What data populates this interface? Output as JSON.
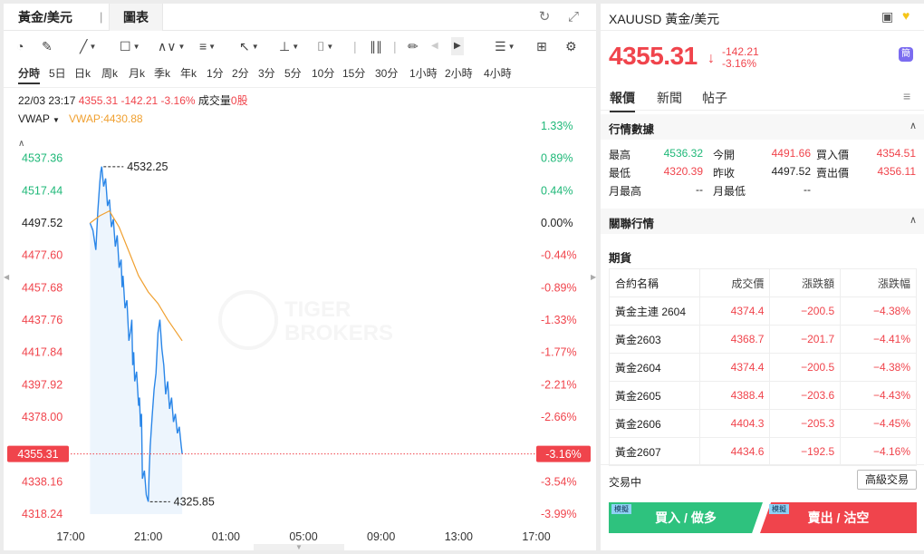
{
  "left_tabs": {
    "symbol": "黃金/美元",
    "separator": "|",
    "chart": "圖表"
  },
  "toolbar_icons": [
    "gauge-icon",
    "pen-icon",
    "line-icon",
    "rect-icon",
    "pattern-icon",
    "fib-icon",
    "arrow-icon",
    "measure-icon",
    "text-icon",
    "bar-icon",
    "eraser-icon",
    "prev-icon",
    "next-icon",
    "layout-icon",
    "grid-icon",
    "settings-icon"
  ],
  "periods": [
    "分時",
    "5日",
    "日k",
    "周k",
    "月k",
    "季k",
    "年k",
    "1分",
    "2分",
    "3分",
    "5分",
    "10分",
    "15分",
    "30分",
    "1小時",
    "2小時",
    "4小時"
  ],
  "active_period": "分時",
  "info": {
    "datetime": "22/03 23:17",
    "price": "4355.31",
    "change": "-142.21",
    "change_pct": "-3.16%",
    "volume_label": "成交量",
    "volume": "0股"
  },
  "indicator": {
    "name": "VWAP",
    "label": "VWAP:4430.88"
  },
  "watermark": {
    "line1": "TIGER",
    "line2": "BROKERS"
  },
  "current_price_tag": "4355.31",
  "current_pct_tag": "-3.16%",
  "colors": {
    "up": "#1fb878",
    "down": "#f0444c",
    "line": "#2a86e8",
    "vwap": "#f0a030",
    "neutral": "#222222"
  },
  "chart_data": {
    "type": "line",
    "x_ticks": [
      "17:00",
      "21:00",
      "01:00",
      "05:00",
      "09:00",
      "13:00",
      "17:00"
    ],
    "x_tick_hours": [
      17,
      21,
      25,
      29,
      33,
      37,
      41
    ],
    "x_range": [
      17,
      41
    ],
    "y_ticks": [
      "4537.36",
      "4517.44",
      "4497.52",
      "4477.60",
      "4457.68",
      "4437.76",
      "4417.84",
      "4397.92",
      "4378.00",
      "4338.16",
      "4318.24"
    ],
    "pct_ticks": [
      "1.33%",
      "0.89%",
      "0.44%",
      "0.00%",
      "-0.44%",
      "-0.89%",
      "-1.33%",
      "-1.77%",
      "-2.21%",
      "-2.66%",
      "-3.54%",
      "-3.99%"
    ],
    "pct_tick_values": [
      4557.28,
      4537.36,
      4517.44,
      4497.52,
      4477.6,
      4457.68,
      4437.76,
      4417.84,
      4397.92,
      4378.0,
      4338.16,
      4318.24
    ],
    "ylim": [
      4318.24,
      4557.28
    ],
    "prev_close": 4497.52,
    "high_label": "4532.25",
    "low_label": "4325.85",
    "high": 4532.25,
    "low": 4325.85,
    "series": [
      {
        "x": [
          18.0,
          18.15,
          18.3,
          18.4,
          18.5,
          18.55,
          18.6,
          18.7,
          18.8,
          18.9,
          19.0,
          19.1,
          19.2,
          19.3,
          19.4,
          19.5,
          19.6,
          19.65,
          19.7,
          19.8,
          19.9,
          20.0,
          20.1,
          20.15,
          20.2,
          20.25,
          20.3,
          20.4,
          20.5,
          20.55,
          20.6,
          20.65,
          20.7,
          20.8,
          20.9,
          21.0,
          21.05,
          21.1,
          21.2,
          21.3,
          21.4,
          21.5,
          21.6,
          21.7,
          21.8,
          21.9,
          22.0,
          22.1,
          22.2,
          22.3,
          22.4,
          22.5,
          22.6,
          22.7,
          22.75
        ],
        "values": [
          4497.5,
          4493.0,
          4481.0,
          4505.0,
          4522.0,
          4529.0,
          4532.3,
          4520.0,
          4525.0,
          4508.0,
          4512.0,
          4495.0,
          4500.0,
          4483.0,
          4490.0,
          4470.0,
          4475.0,
          4458.0,
          4465.0,
          4445.0,
          4450.0,
          4425.0,
          4432.0,
          4438.0,
          4410.0,
          4418.0,
          4400.0,
          4406.0,
          4385.0,
          4390.0,
          4372.0,
          4380.0,
          4340.0,
          4345.0,
          4330.0,
          4325.9,
          4345.0,
          4360.0,
          4378.0,
          4395.0,
          4405.0,
          4430.0,
          4438.0,
          4420.0,
          4410.0,
          4392.0,
          4400.0,
          4383.0,
          4390.0,
          4375.0,
          4380.0,
          4368.0,
          4372.0,
          4360.0,
          4355.3
        ]
      },
      {
        "name": "VWAP",
        "x": [
          18.0,
          18.5,
          19.0,
          19.5,
          20.0,
          20.5,
          21.0,
          21.5,
          22.0,
          22.75
        ],
        "values": [
          4497.5,
          4502.0,
          4505.0,
          4495.0,
          4480.0,
          4465.0,
          4455.0,
          4448.0,
          4438.0,
          4425.0
        ]
      }
    ]
  },
  "right": {
    "title": "XAUUSD 黃金/美元",
    "price": "4355.31",
    "arrow": "↓",
    "change": "-142.21",
    "change_pct": "-3.16%",
    "badge": "簡",
    "tabs": [
      "報價",
      "新聞",
      "帖子"
    ],
    "active_tab": "報價",
    "market_section": "行情數據",
    "rows": [
      [
        {
          "k": "最高",
          "v": "4536.32",
          "c": "up"
        },
        {
          "k": "今開",
          "v": "4491.66",
          "c": "down"
        },
        {
          "k": "買入價",
          "v": "4354.51",
          "c": "down"
        }
      ],
      [
        {
          "k": "最低",
          "v": "4320.39",
          "c": "down"
        },
        {
          "k": "昨收",
          "v": "4497.52",
          "c": "neutral"
        },
        {
          "k": "賣出價",
          "v": "4356.11",
          "c": "down"
        }
      ],
      [
        {
          "k": "月最高",
          "v": "--",
          "c": "neutral"
        },
        {
          "k": "月最低",
          "v": "--",
          "c": "neutral"
        }
      ]
    ],
    "related_section": "關聯行情",
    "futures_label": "期貨",
    "futures_headers": [
      "合約名稱",
      "成交價",
      "漲跌額",
      "漲跌幅"
    ],
    "futures": [
      [
        "黃金主連 2604",
        "4374.4",
        "−200.5",
        "−4.38%"
      ],
      [
        "黃金2603",
        "4368.7",
        "−201.7",
        "−4.41%"
      ],
      [
        "黃金2604",
        "4374.4",
        "−200.5",
        "−4.38%"
      ],
      [
        "黃金2605",
        "4388.4",
        "−203.6",
        "−4.43%"
      ],
      [
        "黃金2606",
        "4404.3",
        "−205.3",
        "−4.45%"
      ],
      [
        "黃金2607",
        "4434.6",
        "−192.5",
        "−4.16%"
      ]
    ],
    "trade_status": "交易中",
    "advanced_button": "高級交易",
    "buy_button": "買入 / 做多",
    "sell_button": "賣出 / 沽空",
    "sim_tag": "模擬"
  }
}
